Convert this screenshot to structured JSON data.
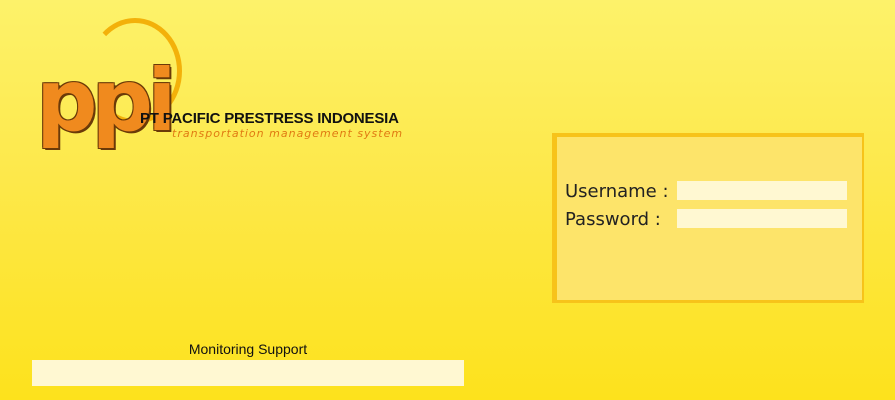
{
  "brand": {
    "logo_letters": "ppi",
    "company_name": "PT PACIFIC PRESTRESS INDONESIA",
    "tagline": "transportation management system"
  },
  "login": {
    "username_label": "Username :",
    "password_label": "Password :",
    "username_value": "",
    "password_value": ""
  },
  "monitoring": {
    "title": "Monitoring Support",
    "content": ""
  },
  "colors": {
    "background_top": "#fdf26a",
    "background_bottom": "#fde21c",
    "logo_orange": "#f08a1e",
    "panel": "#fde46a",
    "panel_shadow": "#f7c31a",
    "input_fill": "#fff8d2"
  }
}
